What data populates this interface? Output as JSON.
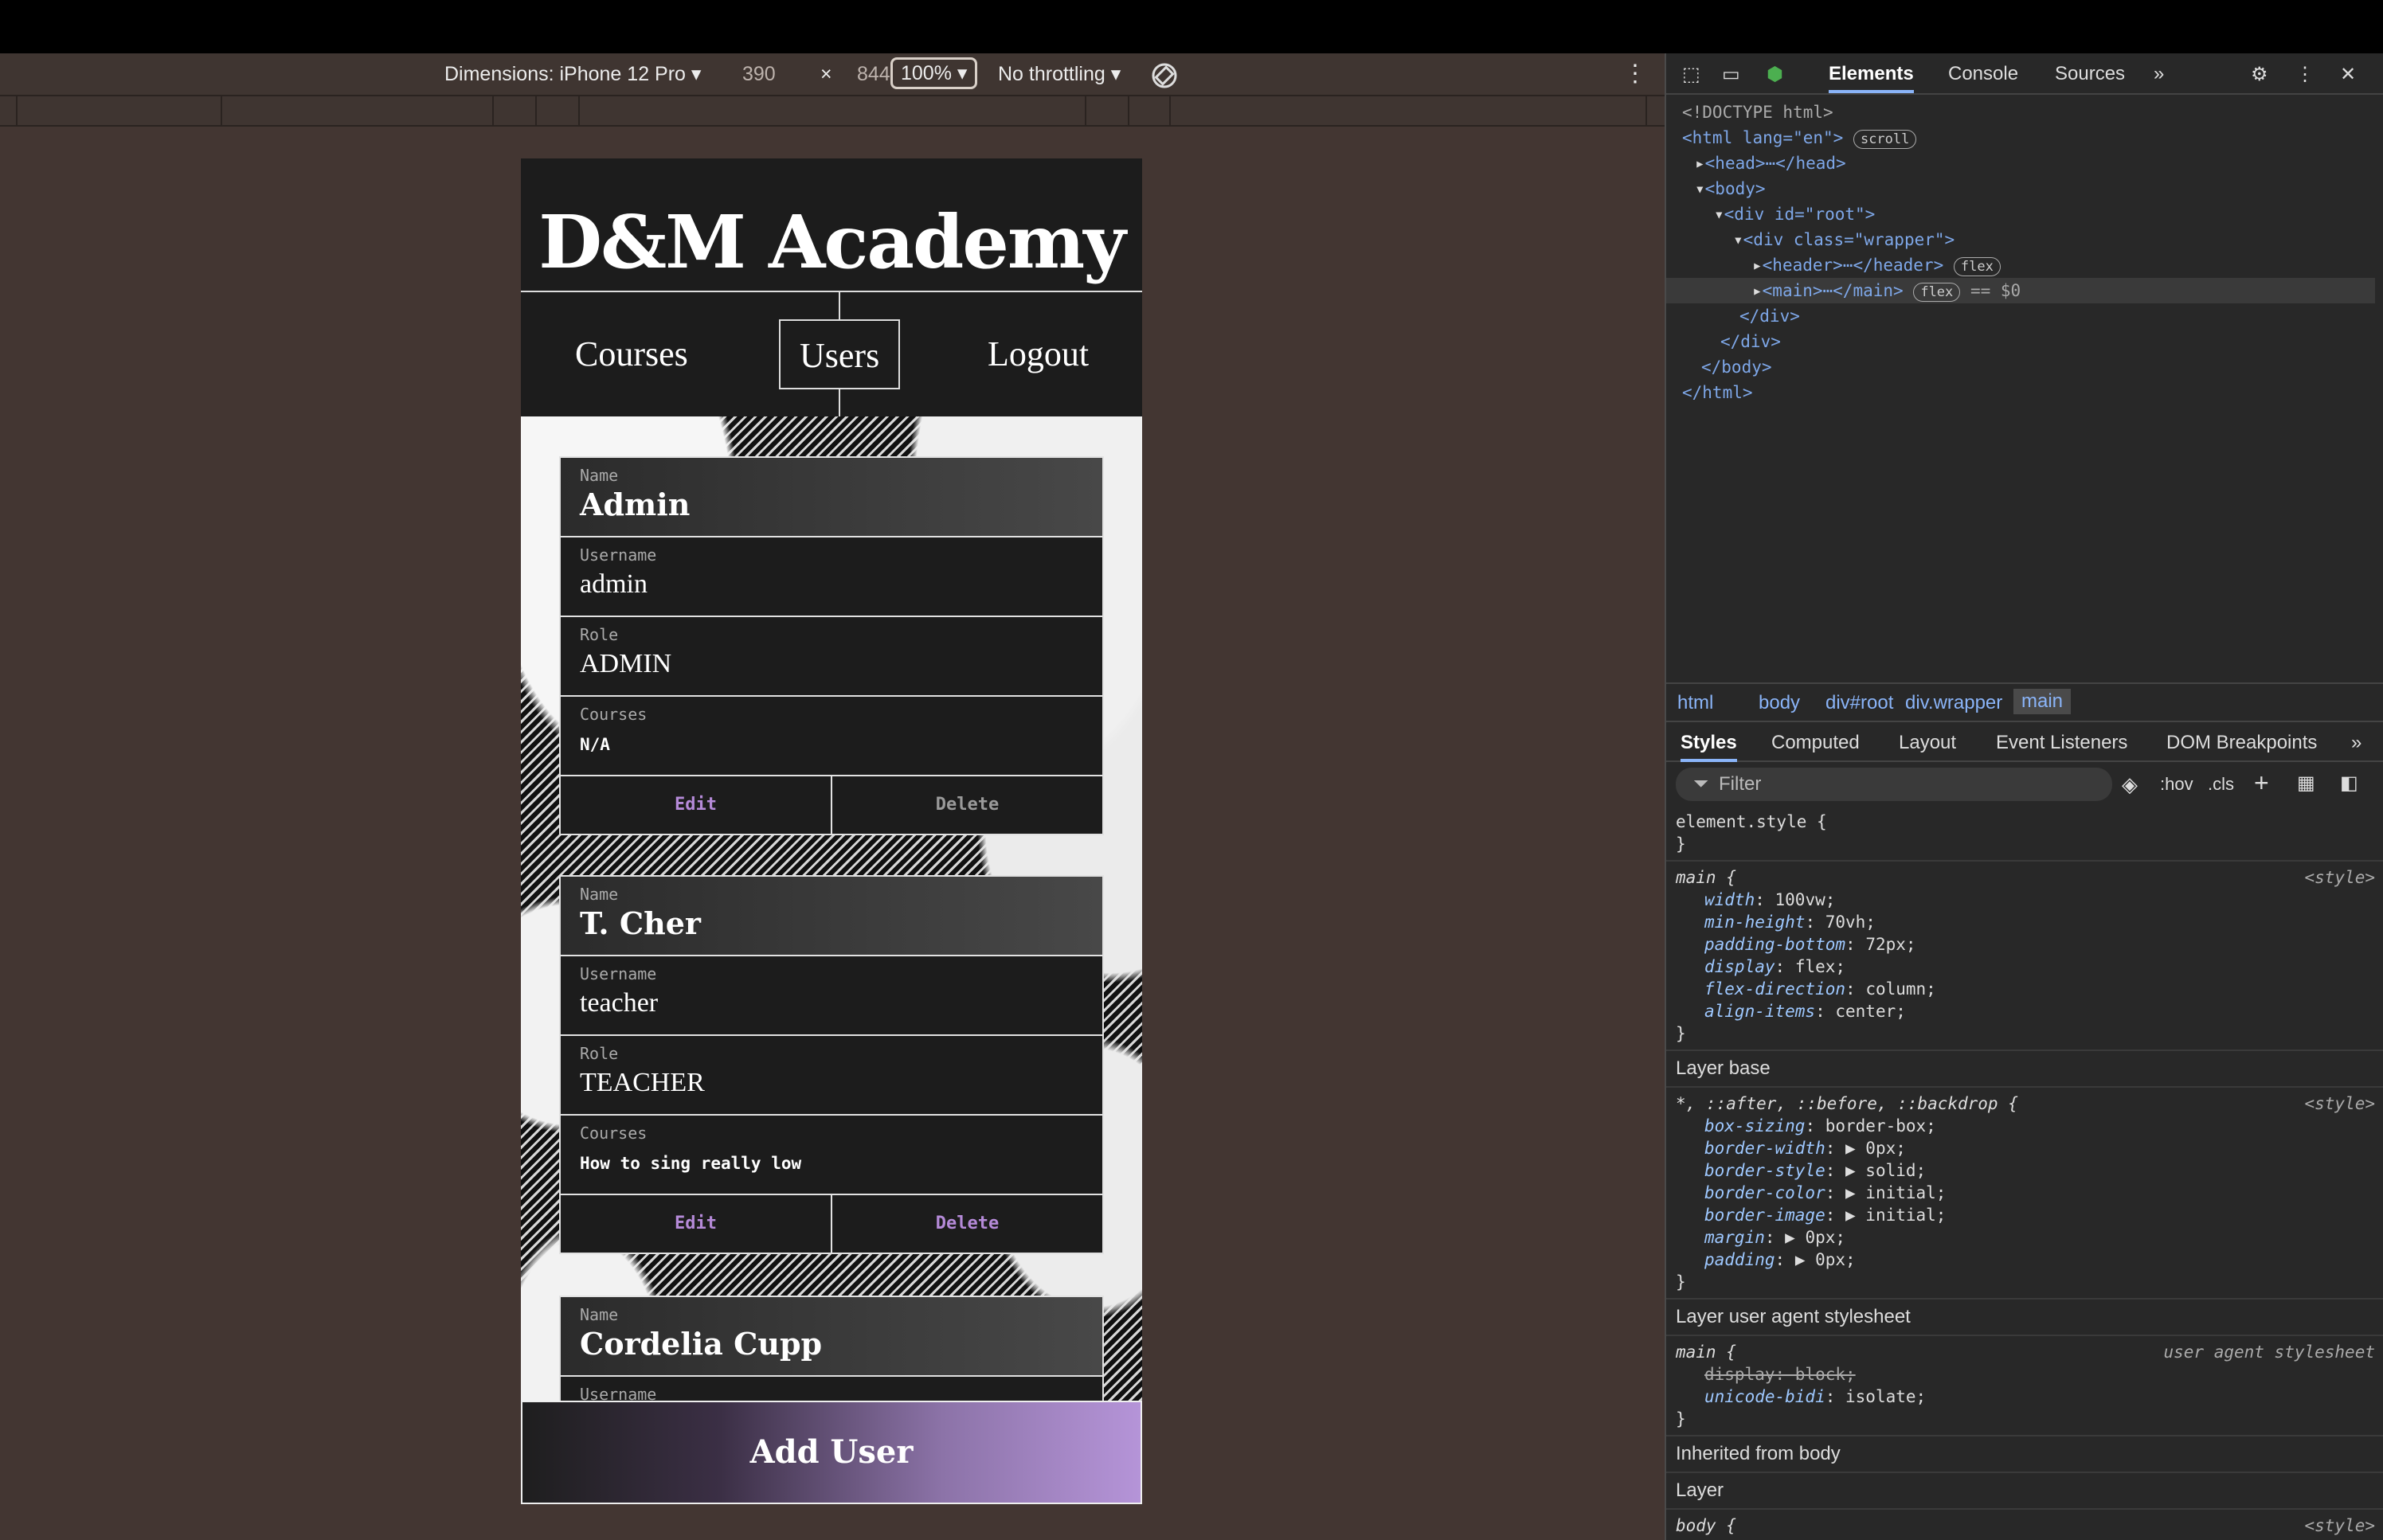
{
  "devtoolbar": {
    "dimensions": "Dimensions: iPhone 12 Pro ▾",
    "width": "390",
    "times": "×",
    "height": "844",
    "zoom": "100% ▾",
    "throttling": "No throttling ▾"
  },
  "app": {
    "title": "D&M Academy",
    "nav": [
      "Courses",
      "Users",
      "Logout"
    ],
    "labels": {
      "name": "Name",
      "username": "Username",
      "role": "Role",
      "courses": "Courses"
    },
    "users": [
      {
        "name": "Admin",
        "username": "admin",
        "role": "ADMIN",
        "courses": "N/A",
        "edit": "Edit",
        "delete": "Delete"
      },
      {
        "name": "T. Cher",
        "username": "teacher",
        "role": "TEACHER",
        "courses": "How to sing really low",
        "edit": "Edit",
        "delete": "Delete"
      },
      {
        "name": "Cordelia Cupp",
        "username": "Username"
      }
    ],
    "add_user": "Add User"
  },
  "devtools": {
    "tabs": [
      "Elements",
      "Console",
      "Sources",
      "»"
    ],
    "dom": {
      "doctype": "<!DOCTYPE html>",
      "html_open": "<html lang=\"en\">",
      "html_pill": "scroll",
      "head": "<head>⋯</head>",
      "body_open": "<body>",
      "root_open": "<div id=\"root\">",
      "wrapper_open": "<div class=\"wrapper\">",
      "header": "<header>⋯</header>",
      "header_pill": "flex",
      "main": "<main>⋯</main>",
      "main_pill": "flex",
      "main_eq": "== $0",
      "div_close": "</div>",
      "body_close": "</body>",
      "html_close": "</html>"
    },
    "breadcrumbs": [
      "html",
      "body",
      "div#root",
      "div.wrapper",
      "main"
    ],
    "style_tabs": [
      "Styles",
      "Computed",
      "Layout",
      "Event Listeners",
      "DOM Breakpoints",
      "»"
    ],
    "filter_placeholder": "Filter",
    "filter_tools": [
      ":hov",
      ".cls"
    ],
    "rules": {
      "element_style": "element.style {",
      "main_selector": "main {",
      "main_source": "<style>",
      "main_props": [
        [
          "width",
          "100vw;"
        ],
        [
          "min-height",
          "70vh;"
        ],
        [
          "padding-bottom",
          "72px;"
        ],
        [
          "display",
          "flex;"
        ],
        [
          "flex-direction",
          "column;"
        ],
        [
          "align-items",
          "center;"
        ]
      ],
      "layer_base": "Layer base",
      "universal_selector": "*, ::after, ::before, ::backdrop {",
      "universal_source": "<style>",
      "universal_props": [
        [
          "box-sizing",
          "border-box;"
        ],
        [
          "border-width",
          "▶ 0px;"
        ],
        [
          "border-style",
          "▶ solid;"
        ],
        [
          "border-color",
          "▶ initial;"
        ],
        [
          "border-image",
          "▶ initial;"
        ],
        [
          "margin",
          "▶ 0px;"
        ],
        [
          "padding",
          "▶ 0px;"
        ]
      ],
      "layer_ua": "Layer user agent stylesheet",
      "ua_selector": "main {",
      "ua_source": "user agent stylesheet",
      "ua_strike": "display: block;",
      "ua_prop": [
        "unicode-bidi",
        "isolate;"
      ],
      "inherited": "Inherited from body",
      "layer": "Layer",
      "body_selector": "body {",
      "body_source": "<style>",
      "close": "}"
    }
  },
  "colors": {
    "accent": "#b58ad8",
    "dev_link": "#8ab4f8",
    "page_bg": "#433632"
  }
}
